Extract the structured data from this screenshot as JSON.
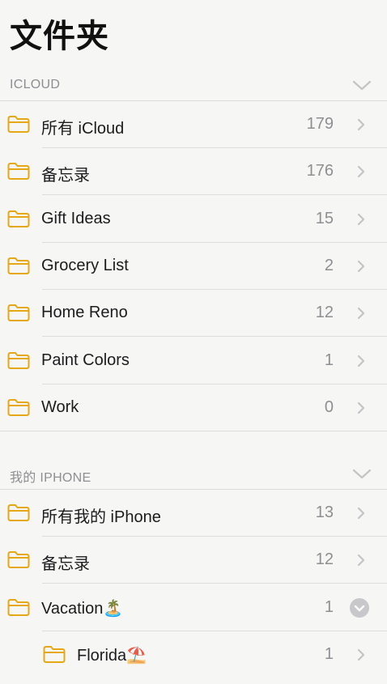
{
  "title": "文件夹",
  "sections": [
    {
      "header": "ICLOUD",
      "folders": [
        {
          "name": "所有 iCloud",
          "count": "179"
        },
        {
          "name": "备忘录",
          "count": "176"
        },
        {
          "name": "Gift Ideas",
          "count": "15"
        },
        {
          "name": "Grocery List",
          "count": "2"
        },
        {
          "name": "Home Reno",
          "count": "12"
        },
        {
          "name": "Paint Colors",
          "count": "1"
        },
        {
          "name": "Work",
          "count": "0"
        }
      ]
    },
    {
      "header": "我的 IPHONE",
      "folders": [
        {
          "name": "所有我的 iPhone",
          "count": "13"
        },
        {
          "name": "备忘录",
          "count": "12"
        },
        {
          "name": "Vacation🏝️",
          "count": "1",
          "expanded": true
        },
        {
          "name": "Florida⛱️",
          "count": "1",
          "subfolder": true
        }
      ]
    }
  ],
  "colors": {
    "folder": "#e6a817",
    "chevron": "#c4c4c7",
    "background": "#f6f6f5"
  },
  "icons": {
    "folder": "folder-icon",
    "chevron": "chevron-right-icon",
    "collapse": "chevron-down-icon",
    "expanded": "chevron-down-circle-icon"
  }
}
